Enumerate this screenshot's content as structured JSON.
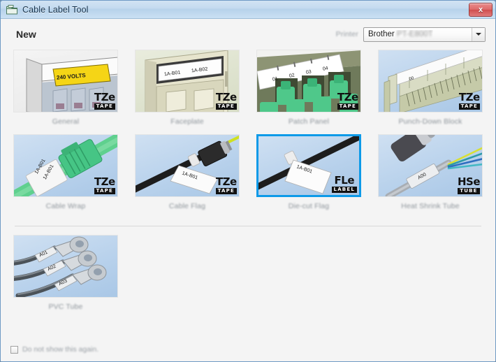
{
  "window": {
    "title": "Cable Label Tool",
    "title_icon": "application-icon",
    "close_label": "x"
  },
  "header": {
    "page_title": "New",
    "printer_label": "Printer",
    "printer_value_prefix": "Brother",
    "printer_value_model": "PT-E800T"
  },
  "tiles": [
    {
      "id": "general",
      "label": "General",
      "badge_big": "TZe",
      "badge_sub": "TAPE",
      "selected": false,
      "art": "breaker-panel",
      "art_text": "240 VOLTS"
    },
    {
      "id": "faceplate",
      "label": "Faceplate",
      "badge_big": "TZe",
      "badge_sub": "TAPE",
      "selected": false,
      "art": "faceplate",
      "art_text": "1A-B01",
      "art_text2": "1A-B02"
    },
    {
      "id": "patch-panel",
      "label": "Patch Panel",
      "badge_big": "TZe",
      "badge_sub": "TAPE",
      "selected": false,
      "art": "patch-panel",
      "art_text": "01",
      "art_text2": "02",
      "art_text3": "03",
      "art_text4": "04"
    },
    {
      "id": "punch-down-block",
      "label": "Punch-Down Block",
      "badge_big": "TZe",
      "badge_sub": "TAPE",
      "selected": false,
      "art": "punch-down-block",
      "art_text": "00"
    },
    {
      "id": "cable-wrap",
      "label": "Cable Wrap",
      "badge_big": "TZe",
      "badge_sub": "TAPE",
      "selected": false,
      "art": "cable-wrap",
      "art_text": "1A-B01",
      "art_text2": "1A-B01"
    },
    {
      "id": "cable-flag",
      "label": "Cable Flag",
      "badge_big": "TZe",
      "badge_sub": "TAPE",
      "selected": false,
      "art": "cable-flag",
      "art_text": "1A-B01"
    },
    {
      "id": "die-cut-flag",
      "label": "Die-cut Flag",
      "badge_big": "FLe",
      "badge_sub": "LABEL",
      "selected": true,
      "art": "die-cut-flag",
      "art_text": "1A-B01"
    },
    {
      "id": "heat-shrink-tube",
      "label": "Heat Shrink Tube",
      "badge_big": "HSe",
      "badge_sub": "TUBE",
      "selected": false,
      "art": "heat-shrink-tube",
      "art_text": "A00"
    },
    {
      "id": "pvc-tube",
      "label": "PVC Tube",
      "badge_big": "",
      "badge_sub": "",
      "selected": false,
      "art": "pvc-tube",
      "art_text": "A01",
      "art_text2": "A02",
      "art_text3": "A03"
    }
  ],
  "footer": {
    "checkbox_label": "Do not show this again.",
    "checkbox_checked": false
  },
  "colors": {
    "selection": "#0d9ae8",
    "titlebar": "#c3daef",
    "close_button": "#cf4d4d",
    "label_text": "#8e959b"
  }
}
